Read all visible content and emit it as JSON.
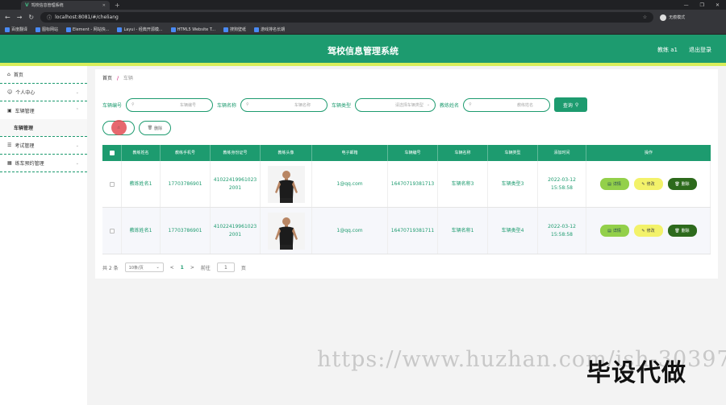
{
  "browser": {
    "tab_title": "驾校信息管理系统",
    "url": "localhost:8081/#/cheliang",
    "profile": "无痕模式",
    "bookmarks": [
      "百度翻译",
      "图标网站",
      "Element - 网站快...",
      "Layui - 经典开源模...",
      "HTML5 Website T...",
      "搜狗壁纸",
      "游戏排名长期"
    ]
  },
  "header": {
    "title": "驾校信息管理系统",
    "user": "教练 a1",
    "logout": "退出登录"
  },
  "sidebar": {
    "items": [
      {
        "label": "首页",
        "icon": "home-icon"
      },
      {
        "label": "个人中心",
        "icon": "user-icon"
      },
      {
        "label": "车辆管理",
        "icon": "car-icon"
      },
      {
        "label": "车辆管理",
        "icon": ""
      },
      {
        "label": "考试管理",
        "icon": "list-icon"
      },
      {
        "label": "练车预约管理",
        "icon": "calendar-icon"
      }
    ]
  },
  "breadcrumb": {
    "home": "首页",
    "sep": "/",
    "current": "车辆"
  },
  "search": {
    "fields": [
      {
        "label": "车辆编号",
        "placeholder": "车辆编号"
      },
      {
        "label": "车辆名称",
        "placeholder": "车辆名称"
      },
      {
        "label": "车辆类型",
        "placeholder": "请选择车辆类型"
      },
      {
        "label": "教练姓名",
        "placeholder": "教练姓名"
      }
    ],
    "button": "查询"
  },
  "actions": {
    "add": "新增",
    "delete": "删除"
  },
  "table": {
    "columns": [
      "教练姓名",
      "教练手机号",
      "教练身份证号",
      "教练头像",
      "电子邮箱",
      "车辆编号",
      "车辆名称",
      "车辆类型",
      "添加时间",
      "操作"
    ],
    "rows": [
      {
        "name": "教练姓名1",
        "phone": "17703786901",
        "idcard": "410224199610232001",
        "email": "1@qq.com",
        "car_no": "16470719381713",
        "car_name": "车辆名称3",
        "car_type": "车辆类型3",
        "time": "2022-03-12 15:58:58"
      },
      {
        "name": "教练姓名1",
        "phone": "17703786901",
        "idcard": "410224199610232001",
        "email": "1@qq.com",
        "car_no": "16470719381711",
        "car_name": "车辆名称1",
        "car_type": "车辆类型4",
        "time": "2022-03-12 15:58:58"
      }
    ],
    "row_actions": {
      "detail": "详情",
      "edit": "修改",
      "delete": "删除"
    }
  },
  "pager": {
    "total": "共 2 条",
    "page_size": "10条/页",
    "prev": "<",
    "page": "1",
    "next": ">",
    "goto": "前往",
    "goto_value": "1",
    "page_suffix": "页"
  },
  "watermark": "https://www.huzhan.com/ish-30397",
  "stamp": "毕设代做",
  "colors": {
    "primary": "#1d9b6f",
    "accent": "#d8ee5a"
  }
}
